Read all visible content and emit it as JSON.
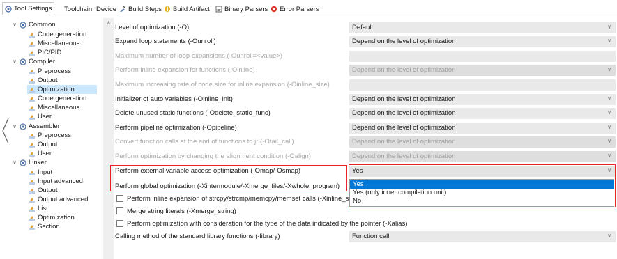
{
  "tabs": [
    {
      "label": "Tool Settings",
      "icon": "tool-settings-icon",
      "active": true
    },
    {
      "label": "Toolchain",
      "icon": null
    },
    {
      "label": "Device",
      "icon": null
    },
    {
      "label": "Build Steps",
      "icon": "build-steps-icon"
    },
    {
      "label": "Build Artifact",
      "icon": "build-artifact-icon"
    },
    {
      "label": "Binary Parsers",
      "icon": "binary-parsers-icon"
    },
    {
      "label": "Error Parsers",
      "icon": "error-parsers-icon"
    }
  ],
  "tree": {
    "common": {
      "label": "Common",
      "children": [
        "Code generation",
        "Miscellaneous",
        "PIC/PID"
      ]
    },
    "compiler": {
      "label": "Compiler",
      "children": [
        "Preprocess",
        "Output",
        "Optimization",
        "Code generation",
        "Miscellaneous",
        "User"
      ]
    },
    "assembler": {
      "label": "Assembler",
      "children": [
        "Preprocess",
        "Output",
        "User"
      ]
    },
    "linker": {
      "label": "Linker",
      "children": [
        "Input",
        "Input advanced",
        "Output",
        "Output advanced",
        "List",
        "Optimization",
        "Section"
      ]
    },
    "selected": "Optimization"
  },
  "settings": [
    {
      "label": "Level of optimization (-O)",
      "value": "Default",
      "enabled": true,
      "type": "combo"
    },
    {
      "label": "Expand loop statements (-Ounroll)",
      "value": "Depend on the level of optimization",
      "enabled": true,
      "type": "combo"
    },
    {
      "label": "Maximum number of loop expansions (-Ounroll=<value>)",
      "value": "",
      "enabled": false,
      "type": "field"
    },
    {
      "label": "Perform inline expansion for functions (-Oinline)",
      "value": "Depend on the level of optimization",
      "enabled": false,
      "type": "combo"
    },
    {
      "label": "Maximum increasing rate of code size for inline expansion (-Oinline_size)",
      "value": "",
      "enabled": false,
      "type": "field"
    },
    {
      "label": "Initializer of auto variables (-Oinline_init)",
      "value": "Depend on the level of optimization",
      "enabled": true,
      "type": "combo"
    },
    {
      "label": "Delete unused static functions (-Odelete_static_func)",
      "value": "Depend on the level of optimization",
      "enabled": true,
      "type": "combo"
    },
    {
      "label": "Perform pipeline optimization (-Opipeline)",
      "value": "Depend on the level of optimization",
      "enabled": true,
      "type": "combo"
    },
    {
      "label": "Convert function calls at the end of functions to jr (-Otail_call)",
      "value": "Depend on the level of optimization",
      "enabled": false,
      "type": "combo"
    },
    {
      "label": "Perform optimization by changing the alignment condition (-Oalign)",
      "value": "Depend on the level of optimization",
      "enabled": false,
      "type": "combo"
    },
    {
      "label": "Perform external variable access optimization (-Omap/-Osmap)",
      "value": "Yes",
      "enabled": true,
      "type": "combo"
    },
    {
      "label": "Perform global optimization (-Xintermodule/-Xmerge_files/-Xwhole_program)",
      "value": "",
      "enabled": true,
      "type": "label"
    },
    {
      "label": "Perform inline expansion of strcpy/strcmp/memcpy/memset calls (-Xinline_s",
      "value": "",
      "enabled": true,
      "type": "check"
    },
    {
      "label": "Merge string literals (-Xmerge_string)",
      "value": "",
      "enabled": true,
      "type": "check"
    },
    {
      "label": "Perform optimization with consideration for the type of the data indicated by the pointer (-Xalias)",
      "value": "",
      "enabled": true,
      "type": "check"
    },
    {
      "label": "Calling method of the standard library functions (-library)",
      "value": "Function call",
      "enabled": true,
      "type": "combo"
    }
  ],
  "dropdown": {
    "options": [
      "Yes",
      "Yes (only inner compilation unit)",
      "No"
    ],
    "highlighted": "Yes"
  },
  "colors": {
    "highlight_box": "#e8222b",
    "selection": "#0078d7",
    "tree_selection": "#cce8ff"
  }
}
